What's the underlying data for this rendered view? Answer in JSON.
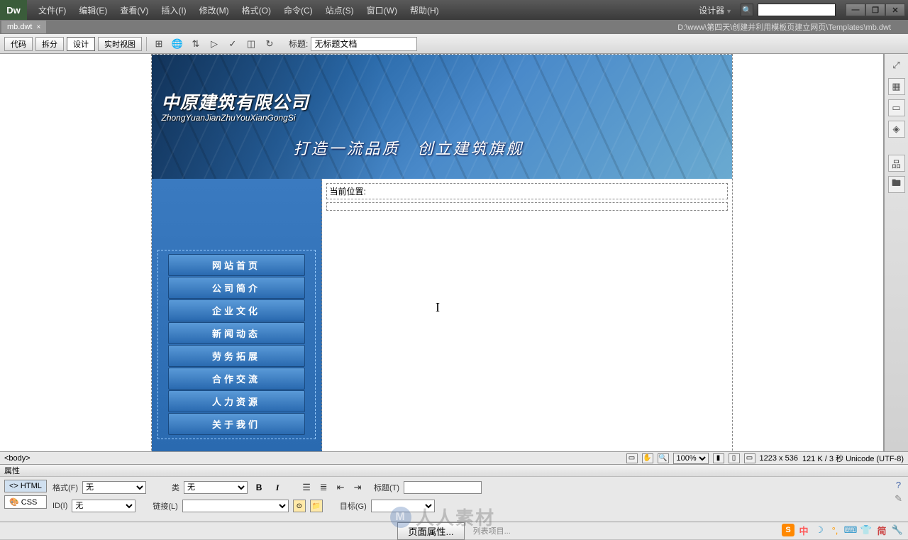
{
  "app": {
    "logo": "Dw"
  },
  "menu": {
    "items": [
      "文件(F)",
      "编辑(E)",
      "查看(V)",
      "插入(I)",
      "修改(M)",
      "格式(O)",
      "命令(C)",
      "站点(S)",
      "窗口(W)",
      "帮助(H)"
    ],
    "designer": "设计器"
  },
  "tab": {
    "name": "mb.dwt",
    "path": "D:\\www\\第四天\\创建并利用模板页建立网页\\Templates\\mb.dwt"
  },
  "toolbar": {
    "code": "代码",
    "split": "拆分",
    "design": "设计",
    "live": "实时视图",
    "title_label": "标题:",
    "title_value": "无标题文档"
  },
  "banner": {
    "title": "中原建筑有限公司",
    "pinyin": "ZhongYuanJianZhuYouXianGongSi",
    "slogan": "打造一流品质　创立建筑旗舰"
  },
  "nav": {
    "items": [
      "网站首页",
      "公司简介",
      "企业文化",
      "新闻动态",
      "劳务拓展",
      "合作交流",
      "人力资源",
      "关于我们"
    ]
  },
  "content": {
    "breadcrumb_label": "当前位置:"
  },
  "status": {
    "tag": "<body>",
    "zoom": "100%",
    "dimensions": "1223 x 536",
    "size_info": "121 K / 3 秒 Unicode (UTF-8)"
  },
  "props": {
    "header": "属性",
    "html_tab": "<> HTML",
    "css_tab": "CSS",
    "format_label": "格式(F)",
    "format_value": "无",
    "id_label": "ID(I)",
    "id_value": "无",
    "class_label": "类",
    "class_value": "无",
    "link_label": "链接(L)",
    "title_label": "标题(T)",
    "target_label": "目标(G)",
    "page_props_btn": "页面属性...",
    "list_item_label": "列表项目..."
  },
  "watermark": "人人素材",
  "tray": {
    "ime": "中",
    "simplified": "简"
  }
}
